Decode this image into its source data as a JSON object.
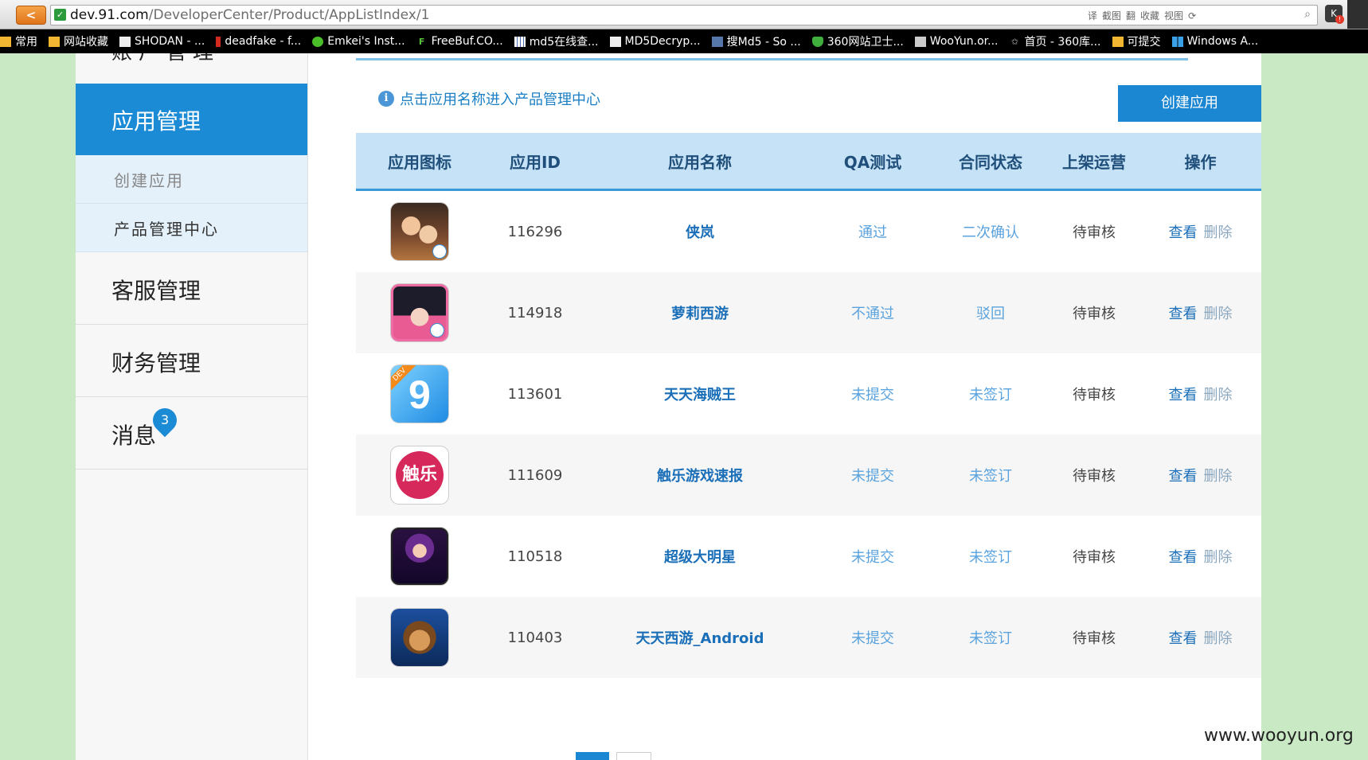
{
  "browser": {
    "url_host": "dev.91.com",
    "url_path": "/DeveloperCenter/Product/AppListIndex/1",
    "back_label": "<",
    "toolbar_icons": [
      "译",
      "截图",
      "翻",
      "收藏",
      "视图"
    ],
    "bookmarks": [
      {
        "label": "常用",
        "icon": "folder-icon"
      },
      {
        "label": "网站收藏",
        "icon": "folder-icon"
      },
      {
        "label": "SHODAN - ...",
        "icon": "page-icon"
      },
      {
        "label": "deadfake - f...",
        "icon": "red-bar-icon"
      },
      {
        "label": "Emkei's Inst...",
        "icon": "green-icon"
      },
      {
        "label": "FreeBuf.CO...",
        "icon": "f-icon"
      },
      {
        "label": "md5在线查...",
        "icon": "grid-icon"
      },
      {
        "label": "MD5Decryp...",
        "icon": "page-icon"
      },
      {
        "label": "搜Md5 - So ...",
        "icon": "site-icon"
      },
      {
        "label": "360网站卫士...",
        "icon": "shield-icon"
      },
      {
        "label": "WooYun.or...",
        "icon": "site-icon"
      },
      {
        "label": "首页 - 360库...",
        "icon": "star-icon"
      },
      {
        "label": "可提交",
        "icon": "folder-icon"
      },
      {
        "label": "Windows A...",
        "icon": "windows-icon"
      }
    ]
  },
  "sidebar": {
    "top_partial": "账户管理",
    "active": "应用管理",
    "subitems": [
      "创建应用",
      "产品管理中心"
    ],
    "items": [
      "客服管理",
      "财务管理",
      "消息"
    ],
    "message_count": "3"
  },
  "main": {
    "hint": "点击应用名称进入产品管理中心",
    "create_button": "创建应用",
    "columns": [
      "应用图标",
      "应用ID",
      "应用名称",
      "QA测试",
      "合同状态",
      "上架运营",
      "操作"
    ],
    "rows": [
      {
        "id": "116296",
        "name": "侠岚",
        "qa": "通过",
        "contract": "二次确认",
        "shelf": "待审核",
        "view": "查看",
        "del": "删除"
      },
      {
        "id": "114918",
        "name": "萝莉西游",
        "qa": "不通过",
        "contract": "驳回",
        "shelf": "待审核",
        "view": "查看",
        "del": "删除"
      },
      {
        "id": "113601",
        "name": "天天海贼王",
        "qa": "未提交",
        "contract": "未签订",
        "shelf": "待审核",
        "view": "查看",
        "del": "删除"
      },
      {
        "id": "111609",
        "name": "触乐游戏速报",
        "qa": "未提交",
        "contract": "未签订",
        "shelf": "待审核",
        "view": "查看",
        "del": "删除"
      },
      {
        "id": "110518",
        "name": "超级大明星",
        "qa": "未提交",
        "contract": "未签订",
        "shelf": "待审核",
        "view": "查看",
        "del": "删除"
      },
      {
        "id": "110403",
        "name": "天天西游_Android",
        "qa": "未提交",
        "contract": "未签订",
        "shelf": "待审核",
        "view": "查看",
        "del": "删除"
      }
    ],
    "icon_texts": {
      "dev": "DEV",
      "chule": "触乐"
    }
  },
  "watermark": "www.wooyun.org",
  "colors": {
    "accent": "#1b8bd6",
    "header_bg": "#c6e2f6",
    "side_bg": "#c9e9c5"
  }
}
